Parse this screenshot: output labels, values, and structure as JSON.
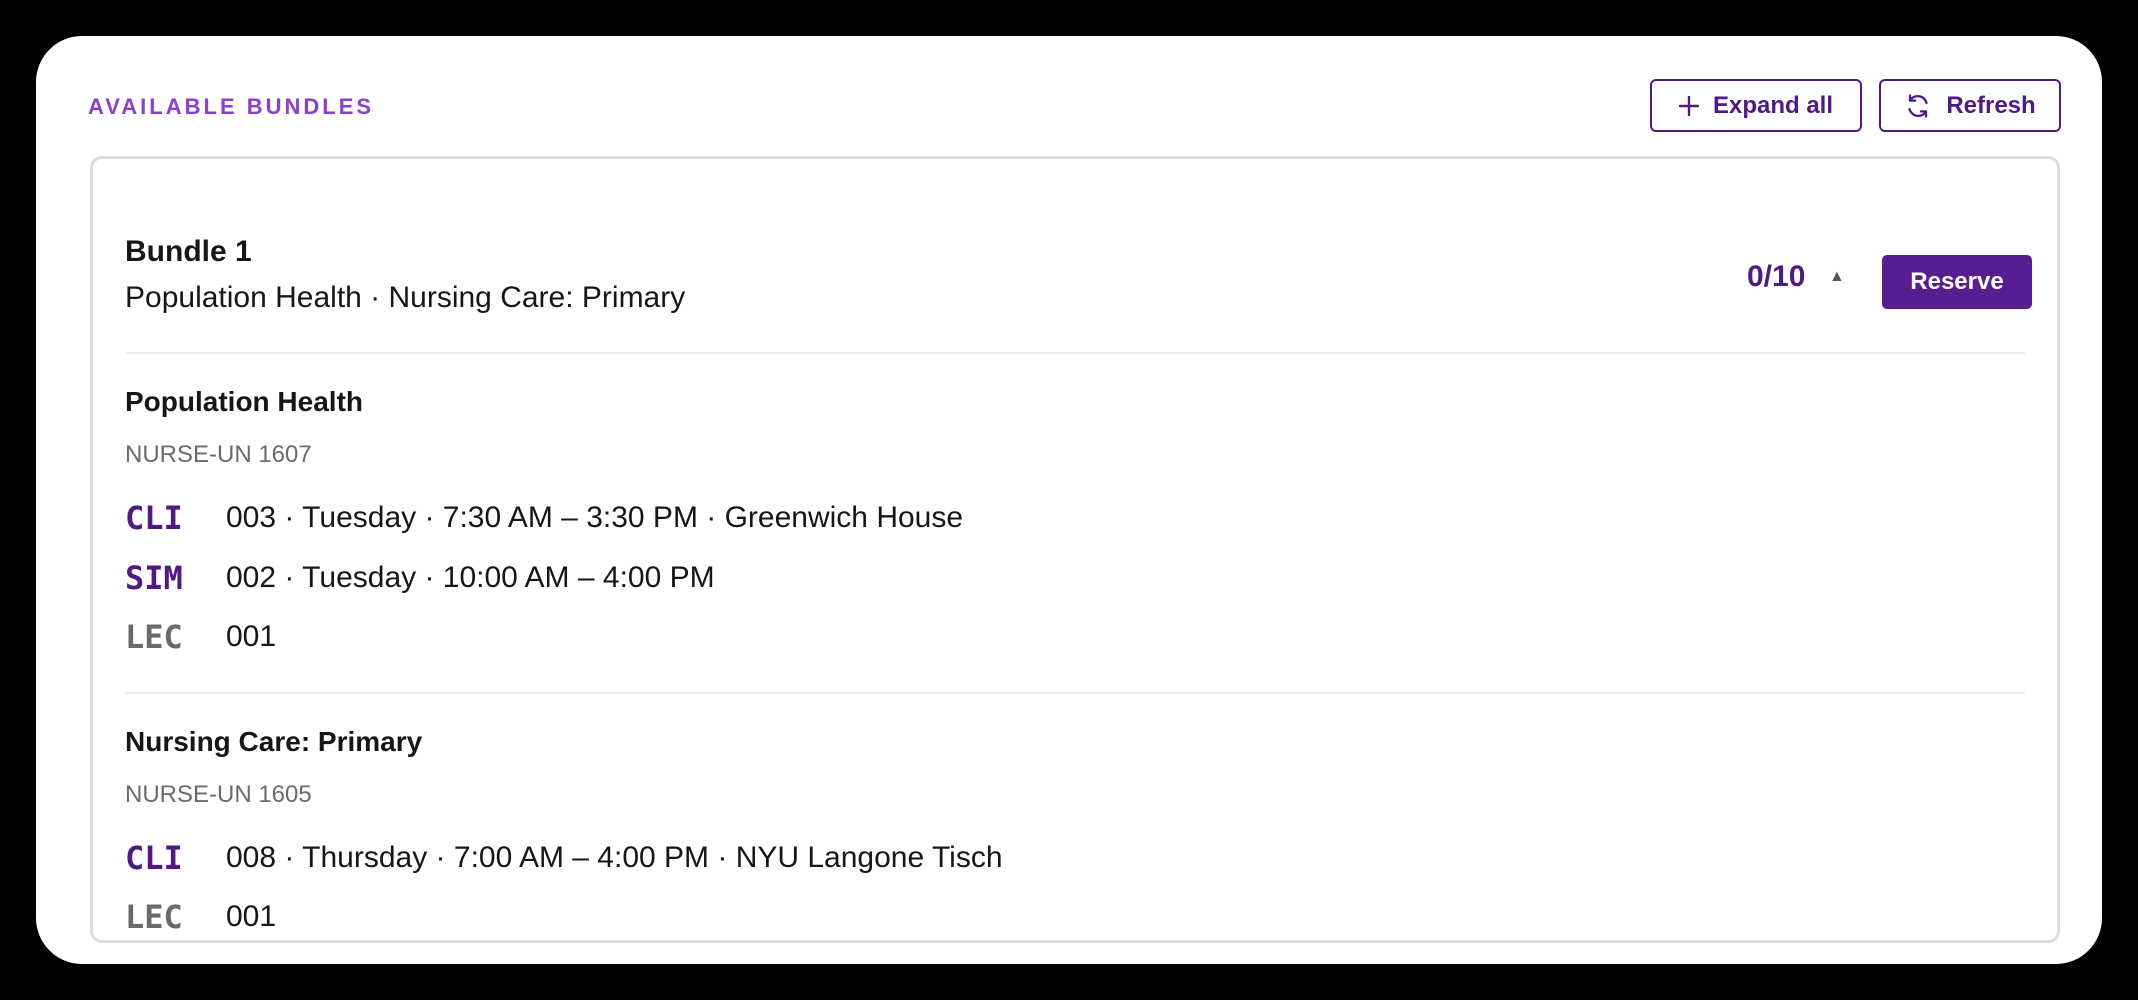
{
  "header": {
    "title": "AVAILABLE BUNDLES",
    "expand_label": "Expand all",
    "refresh_label": "Refresh"
  },
  "colors": {
    "brand": "#581e91",
    "accent": "#8a3fd1",
    "muted": "#6a6a6a"
  },
  "bundle": {
    "name": "Bundle 1",
    "summary": "Population Health · Nursing Care: Primary",
    "count": "0/10",
    "caret": "▲",
    "reserve_label": "Reserve",
    "courses": [
      {
        "title": "Population Health",
        "code": "NURSE-UN 1607",
        "sections": [
          {
            "type": "CLI",
            "detail": "003 · Tuesday · 7:30 AM – 3:30 PM · Greenwich House"
          },
          {
            "type": "SIM",
            "detail": "002 · Tuesday · 10:00 AM – 4:00 PM"
          },
          {
            "type": "LEC",
            "detail": "001"
          }
        ]
      },
      {
        "title": "Nursing Care: Primary",
        "code": "NURSE-UN 1605",
        "sections": [
          {
            "type": "CLI",
            "detail": "008 · Thursday · 7:00 AM – 4:00 PM · NYU Langone Tisch"
          },
          {
            "type": "LEC",
            "detail": "001"
          }
        ]
      }
    ]
  }
}
